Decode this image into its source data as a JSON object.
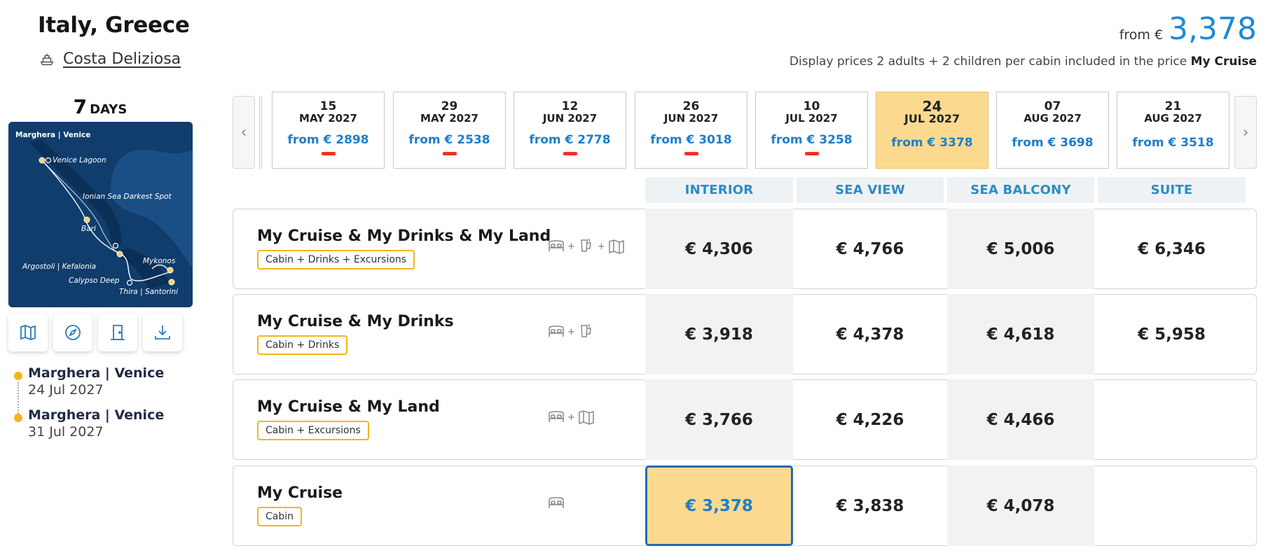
{
  "header": {
    "destination": "Italy, Greece",
    "ship": "Costa Deliziosa",
    "days_num": "7",
    "days_unit": "DAYS",
    "price_from_label": "from €",
    "price_from_value": "3,378",
    "display_note": "Display prices 2 adults + 2 children per cabin included in the price",
    "display_note_bold": "My Cruise"
  },
  "map": {
    "labels": [
      "Marghera | Venice",
      "Venice Lagoon",
      "Ionian Sea Darkest Spot",
      "Bari",
      "Argostoli | Kefalonia",
      "Mykonos",
      "Calypso Deep",
      "Thira | Santorini"
    ]
  },
  "tools": {
    "icons": [
      "map-icon",
      "compass-icon",
      "door-icon",
      "download-icon"
    ]
  },
  "itinerary": [
    {
      "port": "Marghera | Venice",
      "date": "24 Jul 2027"
    },
    {
      "port": "Marghera | Venice",
      "date": "31 Jul 2027"
    }
  ],
  "dates": [
    {
      "day": "15",
      "month": "MAY 2027",
      "price": "from € 2898"
    },
    {
      "day": "29",
      "month": "MAY 2027",
      "price": "from € 2538"
    },
    {
      "day": "12",
      "month": "JUN 2027",
      "price": "from € 2778"
    },
    {
      "day": "26",
      "month": "JUN 2027",
      "price": "from € 3018"
    },
    {
      "day": "10",
      "month": "JUL 2027",
      "price": "from € 3258"
    },
    {
      "day": "24",
      "month": "JUL 2027",
      "price": "from € 3378"
    },
    {
      "day": "07",
      "month": "AUG 2027",
      "price": "from € 3698"
    },
    {
      "day": "21",
      "month": "AUG 2027",
      "price": "from € 3518"
    }
  ],
  "categories": [
    "INTERIOR",
    "SEA VIEW",
    "SEA BALCONY",
    "SUITE"
  ],
  "packages": [
    {
      "name": "My Cruise & My Drinks & My Land",
      "tag": "Cabin + Drinks + Excursions",
      "prices": [
        "€ 4,306",
        "€ 4,766",
        "€ 5,006",
        "€ 6,346"
      ]
    },
    {
      "name": "My Cruise & My Drinks",
      "tag": "Cabin + Drinks",
      "prices": [
        "€ 3,918",
        "€ 4,378",
        "€ 4,618",
        "€ 5,958"
      ]
    },
    {
      "name": "My Cruise & My Land",
      "tag": "Cabin + Excursions",
      "prices": [
        "€ 3,766",
        "€ 4,226",
        "€ 4,466",
        ""
      ]
    },
    {
      "name": "My Cruise",
      "tag": "Cabin",
      "prices": [
        "€ 3,378",
        "€ 3,838",
        "€ 4,078",
        ""
      ]
    }
  ],
  "colors": {
    "accent_blue": "#1d8ad6",
    "selected_yellow": "#fbd98f",
    "tag_border": "#f5b51a",
    "discount_red": "#ee3124"
  }
}
